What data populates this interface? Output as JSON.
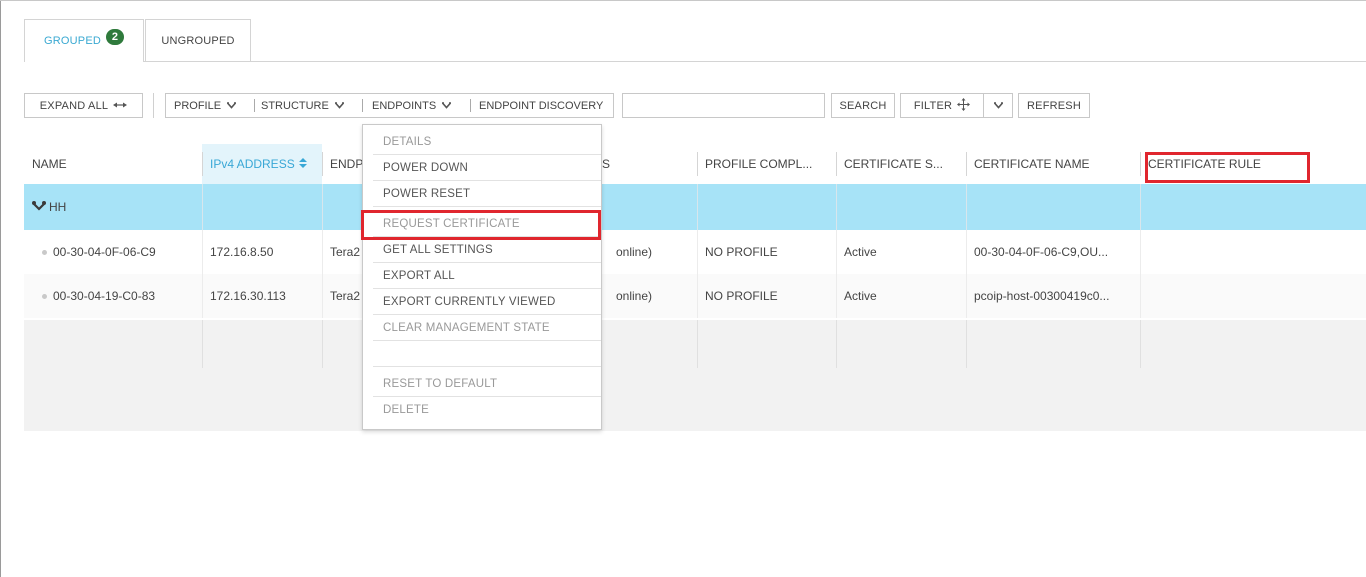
{
  "tabs": [
    {
      "label": "GROUPED",
      "badge": "2"
    },
    {
      "label": "UNGROUPED"
    }
  ],
  "toolbar": {
    "expand_all": "EXPAND ALL",
    "profile": "PROFILE",
    "structure": "STRUCTURE",
    "endpoints": "ENDPOINTS",
    "endpoint_discovery": "ENDPOINT DISCOVERY",
    "search_value": "",
    "search": "SEARCH",
    "filter": "FILTER",
    "refresh": "REFRESH"
  },
  "table": {
    "columns": [
      "NAME",
      "IPv4 ADDRESS",
      "ENDP",
      "S",
      "PROFILE COMPL...",
      "CERTIFICATE S...",
      "CERTIFICATE NAME",
      "CERTIFICATE RULE"
    ],
    "active_column": "IPv4 ADDRESS",
    "group_row": {
      "name": "HH"
    },
    "rows": [
      {
        "name": "00-30-04-0F-06-C9",
        "ipv4": "172.16.8.50",
        "endpoint": "Tera2",
        "status": "online)",
        "profile": "NO PROFILE",
        "cert_status": "Active",
        "cert_name": "00-30-04-0F-06-C9,OU...",
        "cert_rule": ""
      },
      {
        "name": "00-30-04-19-C0-83",
        "ipv4": "172.16.30.113",
        "endpoint": "Tera2",
        "status": "online)",
        "profile": "NO PROFILE",
        "cert_status": "Active",
        "cert_name": "pcoip-host-00300419c0...",
        "cert_rule": ""
      }
    ]
  },
  "menu": {
    "items": [
      {
        "label": "DETAILS",
        "disabled": true
      },
      {
        "label": "POWER DOWN",
        "disabled": false
      },
      {
        "label": "POWER RESET",
        "disabled": false
      },
      {
        "label": "REQUEST CERTIFICATE",
        "disabled": true
      },
      {
        "label": "GET ALL SETTINGS",
        "disabled": false
      },
      {
        "label": "EXPORT ALL",
        "disabled": false
      },
      {
        "label": "EXPORT CURRENTLY VIEWED",
        "disabled": false
      },
      {
        "label": "CLEAR MANAGEMENT STATE",
        "disabled": true
      },
      {
        "label": "",
        "disabled": false
      },
      {
        "label": "RESET TO DEFAULT",
        "disabled": true
      },
      {
        "label": "DELETE",
        "disabled": true
      }
    ]
  },
  "colors": {
    "accent": "#38a7d6",
    "group_row": "#a7e3f7",
    "highlight": "#e0262e",
    "badge": "#2f7a3c"
  },
  "icons": {
    "expand_all": "collapse-arrows-icon",
    "dropdown": "chevron-down-icon",
    "filter": "move-arrows-icon",
    "group": "group-icon",
    "sort": "sort-icon"
  }
}
